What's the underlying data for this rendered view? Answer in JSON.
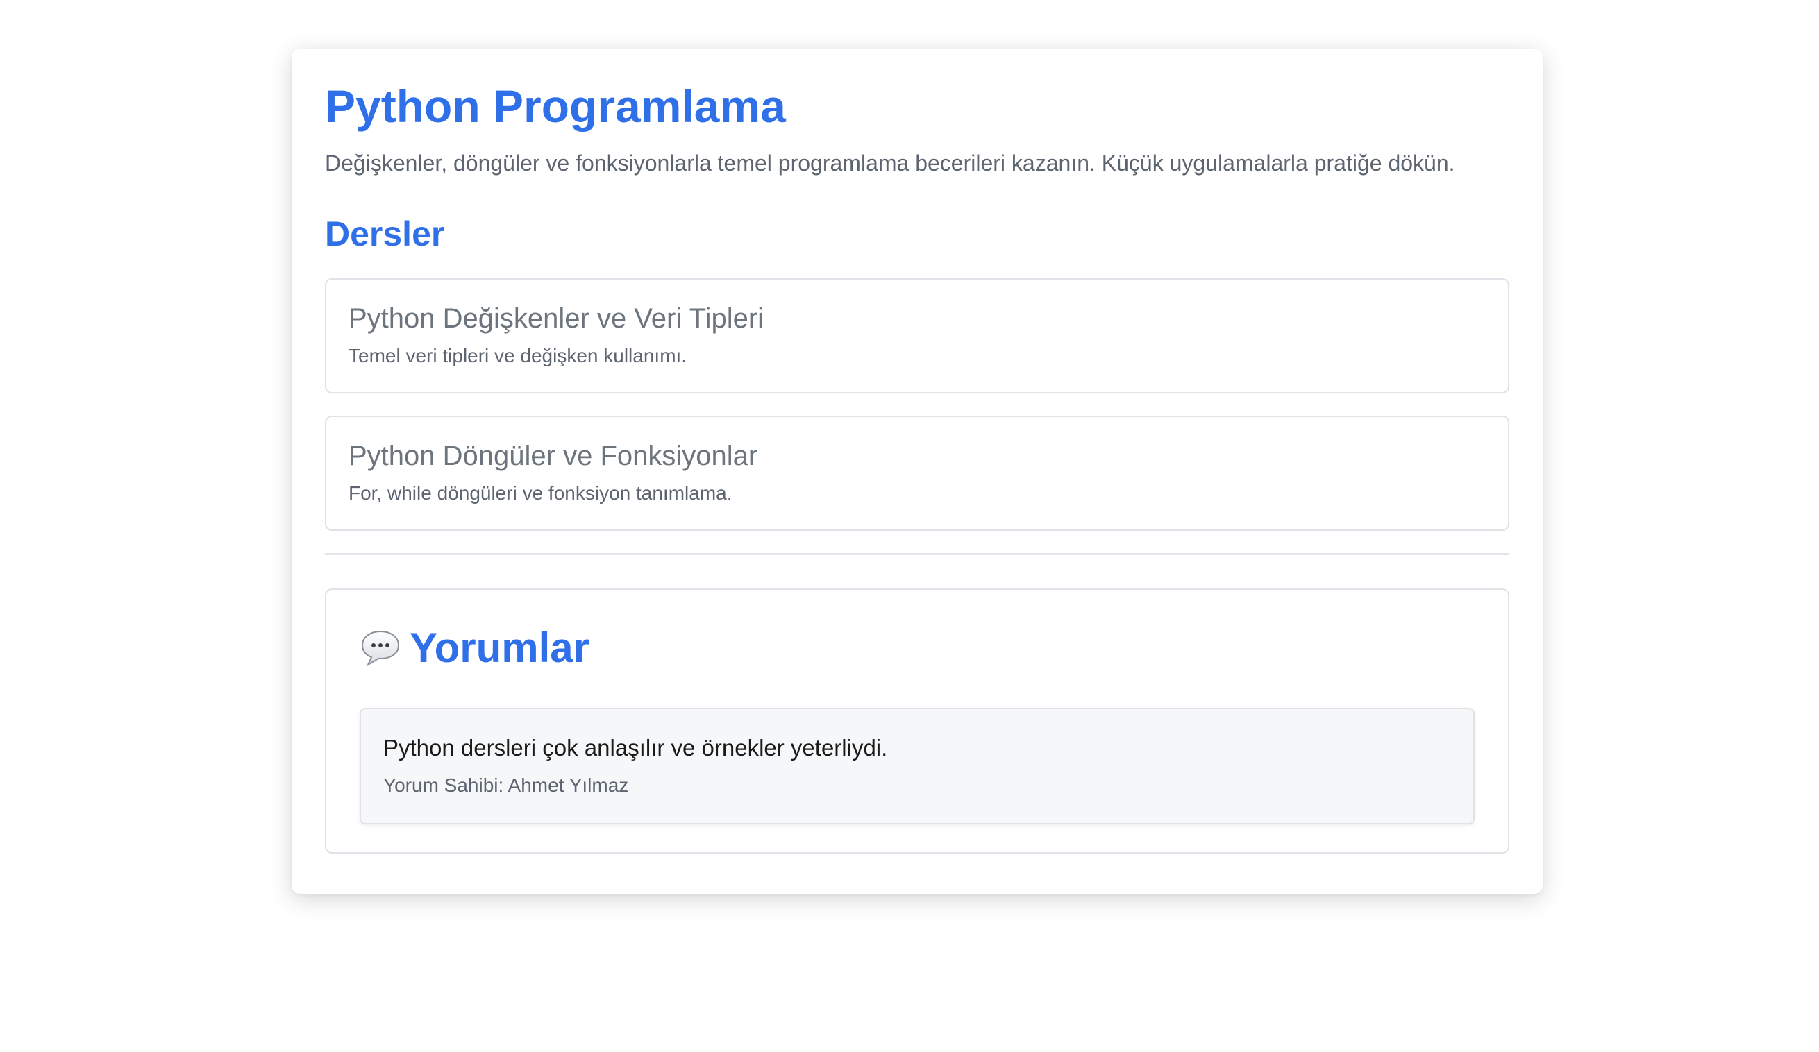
{
  "course": {
    "title": "Python Programlama",
    "description": "Değişkenler, döngüler ve fonksiyonlarla temel programlama becerileri kazanın. Küçük uygulamalarla pratiğe dökün."
  },
  "lessons": {
    "heading": "Dersler",
    "items": [
      {
        "title": "Python Değişkenler ve Veri Tipleri",
        "description": "Temel veri tipleri ve değişken kullanımı."
      },
      {
        "title": "Python Döngüler ve Fonksiyonlar",
        "description": "For, while döngüleri ve fonksiyon tanımlama."
      }
    ]
  },
  "comments": {
    "icon": "speech-bubble-icon",
    "heading": "Yorumlar",
    "items": [
      {
        "text": "Python dersleri çok anlaşılır ve örnekler yeterliydi.",
        "author": "Yorum Sahibi: Ahmet Yılmaz"
      }
    ]
  },
  "colors": {
    "accent": "#2f6fe8",
    "muted_text": "#5c6470",
    "border": "#dfe2e6",
    "comment_bg": "#f6f7f9"
  }
}
